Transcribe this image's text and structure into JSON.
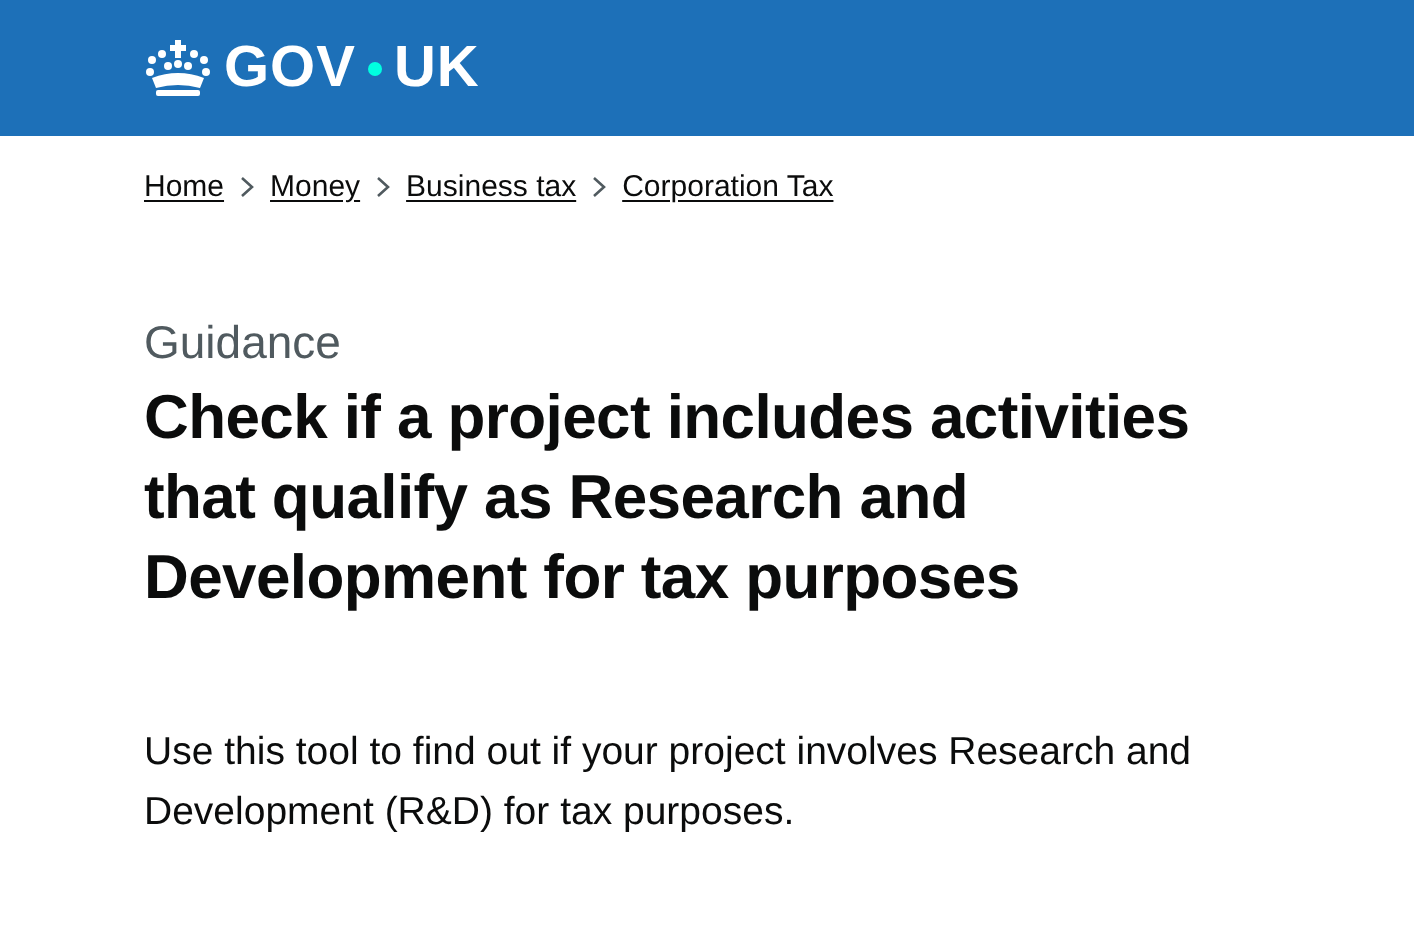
{
  "header": {
    "logo": {
      "left": "GOV",
      "right": "UK"
    }
  },
  "breadcrumbs": [
    {
      "label": "Home"
    },
    {
      "label": "Money"
    },
    {
      "label": "Business tax"
    },
    {
      "label": "Corporation Tax"
    }
  ],
  "caption": "Guidance",
  "title": "Check if a project includes activities that qualify as Research and Development for tax purposes",
  "lead": "Use this tool to find out if your project involves Research and Development (R&D) for tax purposes."
}
